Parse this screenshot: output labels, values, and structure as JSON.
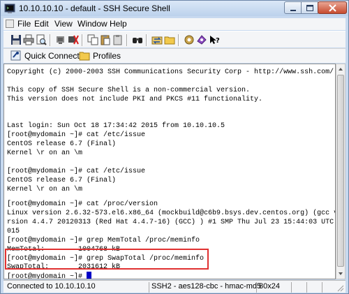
{
  "window": {
    "title": "10.10.10.10 - default - SSH Secure Shell"
  },
  "menu": [
    "File",
    "Edit",
    "View",
    "Window",
    "Help"
  ],
  "toolbar": {
    "buttons": [
      "save-icon",
      "print-icon",
      "print-preview-icon",
      "disconnect-icon",
      "settings-icon",
      "copy-icon",
      "paste-icon",
      "paste-alt-icon",
      "find-icon",
      "settings-gear-icon",
      "key-icon",
      "profile-icon",
      "help-icon"
    ]
  },
  "linkbar": {
    "quick_connect": "Quick Connect",
    "profiles": "Profiles"
  },
  "terminal": {
    "lines": [
      "Copyright (c) 2000-2003 SSH Communications Security Corp - http://www.ssh.com/",
      "",
      "This copy of SSH Secure Shell is a non-commercial version.",
      "This version does not include PKI and PKCS #11 functionality.",
      "",
      "",
      "Last login: Sun Oct 18 17:34:42 2015 from 10.10.10.5",
      "[root@mydomain ~]# cat /etc/issue",
      "CentOS release 6.7 (Final)",
      "Kernel \\r on an \\m",
      "",
      "[root@mydomain ~]# cat /etc/issue",
      "CentOS release 6.7 (Final)",
      "Kernel \\r on an \\m",
      "",
      "[root@mydomain ~]# cat /proc/version",
      "Linux version 2.6.32-573.el6.x86_64 (mockbuild@c6b9.bsys.dev.centos.org) (gcc ve",
      "rsion 4.4.7 20120313 (Red Hat 4.4.7-16) (GCC) ) #1 SMP Thu Jul 23 15:44:03 UTC 2",
      "015",
      "[root@mydomain ~]# grep MemTotal /proc/meminfo",
      "MemTotal:        1004768 kB",
      "[root@mydomain ~]# grep SwapTotal /proc/meminfo",
      "SwapTotal:       2031612 kB",
      "[root@mydomain ~]# "
    ]
  },
  "status": {
    "connection": "Connected to 10.10.10.10",
    "cipher": "SSH2 - aes128-cbc - hmac-md5",
    "size": "80x24"
  }
}
